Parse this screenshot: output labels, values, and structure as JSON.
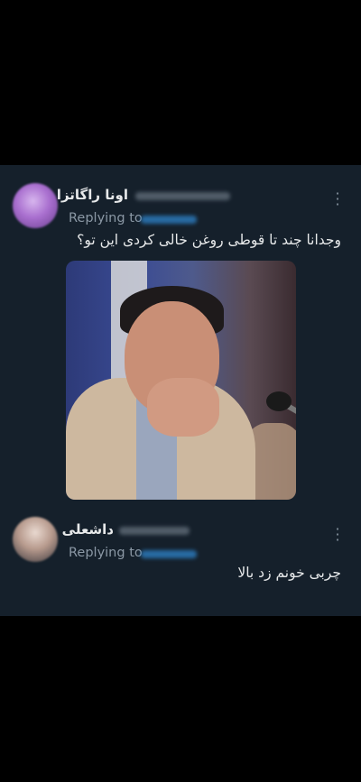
{
  "tweets": [
    {
      "author_name": "اونا راگاتزا",
      "replying_label": "Replying to",
      "text": "وجدانا چند تا قوطی روغن خالی کردی این تو؟",
      "more_icon": "⋮",
      "has_media": true
    },
    {
      "author_name": "داشعلی",
      "replying_label": "Replying to",
      "text": "چربی خونم زد بالا",
      "more_icon": "⋮",
      "has_media": false
    }
  ],
  "colors": {
    "background": "#000000",
    "card": "#15202b",
    "text_primary": "#e7e9ea",
    "text_secondary": "#8b98a5",
    "link": "#1d9bf0"
  }
}
